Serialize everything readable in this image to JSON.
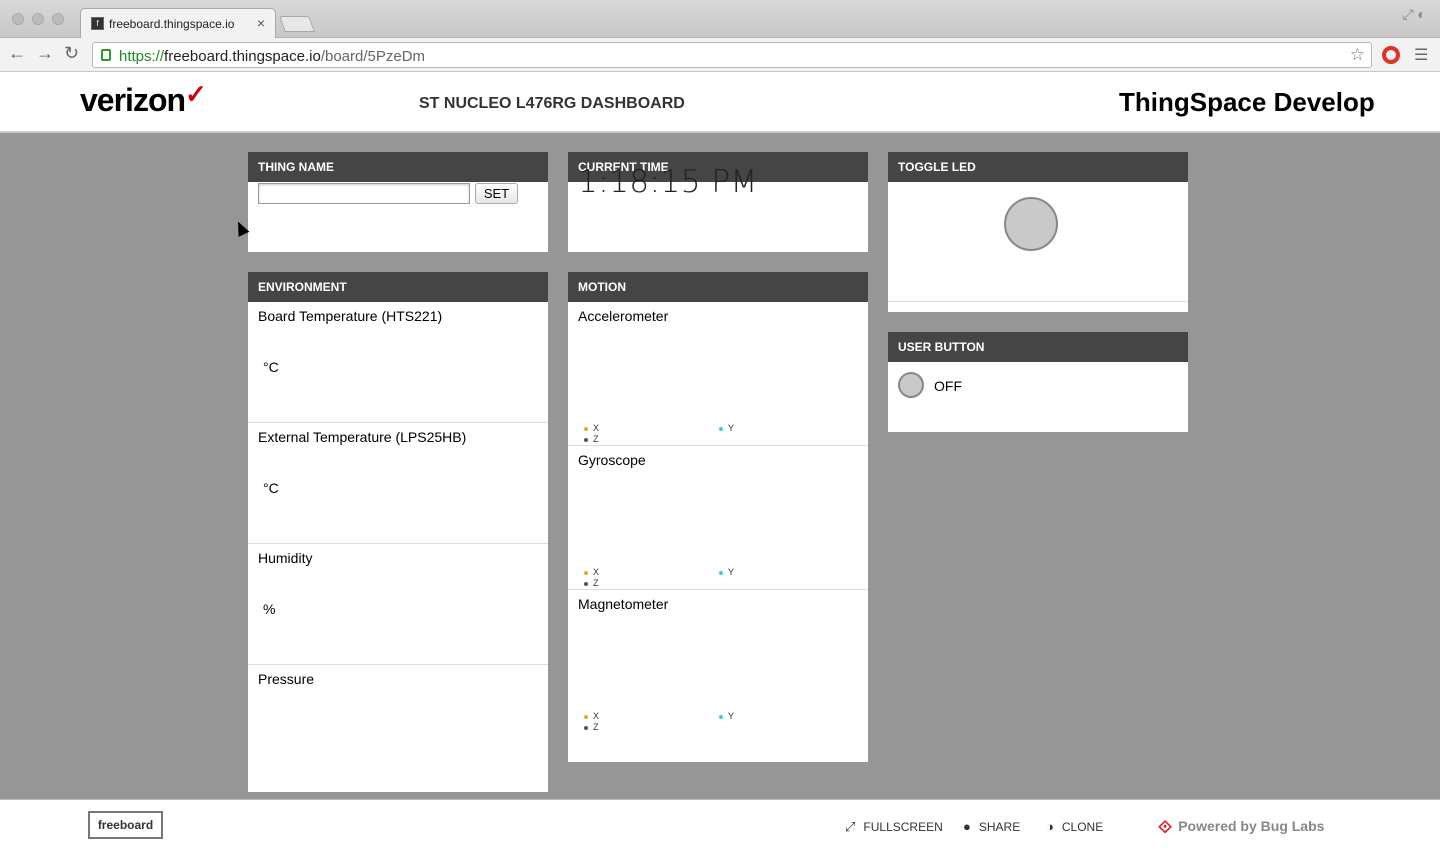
{
  "browser": {
    "tab_title": "freeboard.thingspace.io",
    "tab_close": "×",
    "url_scheme": "https://",
    "url_host": "freeboard.thingspace.io",
    "url_path": "/board/5PzeDm"
  },
  "header": {
    "logo": "verizon",
    "logo_check": "✓",
    "dashboard_title": "ST NUCLEO L476RG DASHBOARD",
    "brand": "ThingSpace Develop"
  },
  "panes": {
    "thing_name": {
      "title": "THING NAME",
      "input_value": "",
      "set_label": "SET"
    },
    "current_time": {
      "title": "CURRENT TIME",
      "value": "1:18:15 PM"
    },
    "toggle_led": {
      "title": "TOGGLE LED"
    },
    "environment": {
      "title": "ENVIRONMENT",
      "sections": [
        {
          "label": "Board Temperature (HTS221)",
          "unit": "°C"
        },
        {
          "label": "External Temperature (LPS25HB)",
          "unit": "°C"
        },
        {
          "label": "Humidity",
          "unit": "%"
        },
        {
          "label": "Pressure",
          "unit": ""
        }
      ]
    },
    "motion": {
      "title": "MOTION",
      "sections": [
        {
          "label": "Accelerometer"
        },
        {
          "label": "Gyroscope"
        },
        {
          "label": "Magnetometer"
        }
      ],
      "legend": {
        "x": "X",
        "y": "Y",
        "z": "Z"
      },
      "legend_colors": {
        "x": "#f0a030",
        "y": "#30d0d8",
        "z": "#555555"
      }
    },
    "user_button": {
      "title": "USER BUTTON",
      "state": "OFF"
    }
  },
  "footer": {
    "freeboard": "freeboard",
    "fullscreen": "FULLSCREEN",
    "share": "SHARE",
    "clone": "CLONE",
    "powered_by": "Powered by Bug Labs"
  },
  "icons": [
    "favicon-icon",
    "back-icon",
    "forward-icon",
    "reload-icon",
    "lock-icon",
    "star-icon",
    "extension-icon",
    "menu-icon",
    "fullscreen-icon",
    "share-icon",
    "clone-icon",
    "bug-labs-logo-icon"
  ]
}
